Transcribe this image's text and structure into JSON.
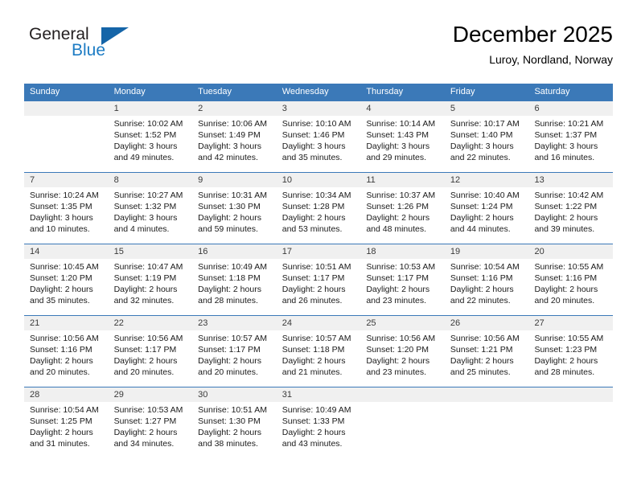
{
  "brand": {
    "word_one": "General",
    "word_two": "Blue",
    "accent_dark": "#1565a8",
    "accent_light": "#1d7cc4"
  },
  "header": {
    "title": "December 2025",
    "subtitle": "Luroy, Nordland, Norway"
  },
  "calendar": {
    "header_color": "#3b79b8",
    "daynum_band_color": "#f0f0f0",
    "weekdays": [
      "Sunday",
      "Monday",
      "Tuesday",
      "Wednesday",
      "Thursday",
      "Friday",
      "Saturday"
    ],
    "weeks": [
      {
        "days": [
          {
            "num": "",
            "sunrise": "",
            "sunset": "",
            "daylight_a": "",
            "daylight_b": ""
          },
          {
            "num": "1",
            "sunrise": "Sunrise: 10:02 AM",
            "sunset": "Sunset: 1:52 PM",
            "daylight_a": "Daylight: 3 hours",
            "daylight_b": "and 49 minutes."
          },
          {
            "num": "2",
            "sunrise": "Sunrise: 10:06 AM",
            "sunset": "Sunset: 1:49 PM",
            "daylight_a": "Daylight: 3 hours",
            "daylight_b": "and 42 minutes."
          },
          {
            "num": "3",
            "sunrise": "Sunrise: 10:10 AM",
            "sunset": "Sunset: 1:46 PM",
            "daylight_a": "Daylight: 3 hours",
            "daylight_b": "and 35 minutes."
          },
          {
            "num": "4",
            "sunrise": "Sunrise: 10:14 AM",
            "sunset": "Sunset: 1:43 PM",
            "daylight_a": "Daylight: 3 hours",
            "daylight_b": "and 29 minutes."
          },
          {
            "num": "5",
            "sunrise": "Sunrise: 10:17 AM",
            "sunset": "Sunset: 1:40 PM",
            "daylight_a": "Daylight: 3 hours",
            "daylight_b": "and 22 minutes."
          },
          {
            "num": "6",
            "sunrise": "Sunrise: 10:21 AM",
            "sunset": "Sunset: 1:37 PM",
            "daylight_a": "Daylight: 3 hours",
            "daylight_b": "and 16 minutes."
          }
        ]
      },
      {
        "days": [
          {
            "num": "7",
            "sunrise": "Sunrise: 10:24 AM",
            "sunset": "Sunset: 1:35 PM",
            "daylight_a": "Daylight: 3 hours",
            "daylight_b": "and 10 minutes."
          },
          {
            "num": "8",
            "sunrise": "Sunrise: 10:27 AM",
            "sunset": "Sunset: 1:32 PM",
            "daylight_a": "Daylight: 3 hours",
            "daylight_b": "and 4 minutes."
          },
          {
            "num": "9",
            "sunrise": "Sunrise: 10:31 AM",
            "sunset": "Sunset: 1:30 PM",
            "daylight_a": "Daylight: 2 hours",
            "daylight_b": "and 59 minutes."
          },
          {
            "num": "10",
            "sunrise": "Sunrise: 10:34 AM",
            "sunset": "Sunset: 1:28 PM",
            "daylight_a": "Daylight: 2 hours",
            "daylight_b": "and 53 minutes."
          },
          {
            "num": "11",
            "sunrise": "Sunrise: 10:37 AM",
            "sunset": "Sunset: 1:26 PM",
            "daylight_a": "Daylight: 2 hours",
            "daylight_b": "and 48 minutes."
          },
          {
            "num": "12",
            "sunrise": "Sunrise: 10:40 AM",
            "sunset": "Sunset: 1:24 PM",
            "daylight_a": "Daylight: 2 hours",
            "daylight_b": "and 44 minutes."
          },
          {
            "num": "13",
            "sunrise": "Sunrise: 10:42 AM",
            "sunset": "Sunset: 1:22 PM",
            "daylight_a": "Daylight: 2 hours",
            "daylight_b": "and 39 minutes."
          }
        ]
      },
      {
        "days": [
          {
            "num": "14",
            "sunrise": "Sunrise: 10:45 AM",
            "sunset": "Sunset: 1:20 PM",
            "daylight_a": "Daylight: 2 hours",
            "daylight_b": "and 35 minutes."
          },
          {
            "num": "15",
            "sunrise": "Sunrise: 10:47 AM",
            "sunset": "Sunset: 1:19 PM",
            "daylight_a": "Daylight: 2 hours",
            "daylight_b": "and 32 minutes."
          },
          {
            "num": "16",
            "sunrise": "Sunrise: 10:49 AM",
            "sunset": "Sunset: 1:18 PM",
            "daylight_a": "Daylight: 2 hours",
            "daylight_b": "and 28 minutes."
          },
          {
            "num": "17",
            "sunrise": "Sunrise: 10:51 AM",
            "sunset": "Sunset: 1:17 PM",
            "daylight_a": "Daylight: 2 hours",
            "daylight_b": "and 26 minutes."
          },
          {
            "num": "18",
            "sunrise": "Sunrise: 10:53 AM",
            "sunset": "Sunset: 1:17 PM",
            "daylight_a": "Daylight: 2 hours",
            "daylight_b": "and 23 minutes."
          },
          {
            "num": "19",
            "sunrise": "Sunrise: 10:54 AM",
            "sunset": "Sunset: 1:16 PM",
            "daylight_a": "Daylight: 2 hours",
            "daylight_b": "and 22 minutes."
          },
          {
            "num": "20",
            "sunrise": "Sunrise: 10:55 AM",
            "sunset": "Sunset: 1:16 PM",
            "daylight_a": "Daylight: 2 hours",
            "daylight_b": "and 20 minutes."
          }
        ]
      },
      {
        "days": [
          {
            "num": "21",
            "sunrise": "Sunrise: 10:56 AM",
            "sunset": "Sunset: 1:16 PM",
            "daylight_a": "Daylight: 2 hours",
            "daylight_b": "and 20 minutes."
          },
          {
            "num": "22",
            "sunrise": "Sunrise: 10:56 AM",
            "sunset": "Sunset: 1:17 PM",
            "daylight_a": "Daylight: 2 hours",
            "daylight_b": "and 20 minutes."
          },
          {
            "num": "23",
            "sunrise": "Sunrise: 10:57 AM",
            "sunset": "Sunset: 1:17 PM",
            "daylight_a": "Daylight: 2 hours",
            "daylight_b": "and 20 minutes."
          },
          {
            "num": "24",
            "sunrise": "Sunrise: 10:57 AM",
            "sunset": "Sunset: 1:18 PM",
            "daylight_a": "Daylight: 2 hours",
            "daylight_b": "and 21 minutes."
          },
          {
            "num": "25",
            "sunrise": "Sunrise: 10:56 AM",
            "sunset": "Sunset: 1:20 PM",
            "daylight_a": "Daylight: 2 hours",
            "daylight_b": "and 23 minutes."
          },
          {
            "num": "26",
            "sunrise": "Sunrise: 10:56 AM",
            "sunset": "Sunset: 1:21 PM",
            "daylight_a": "Daylight: 2 hours",
            "daylight_b": "and 25 minutes."
          },
          {
            "num": "27",
            "sunrise": "Sunrise: 10:55 AM",
            "sunset": "Sunset: 1:23 PM",
            "daylight_a": "Daylight: 2 hours",
            "daylight_b": "and 28 minutes."
          }
        ]
      },
      {
        "days": [
          {
            "num": "28",
            "sunrise": "Sunrise: 10:54 AM",
            "sunset": "Sunset: 1:25 PM",
            "daylight_a": "Daylight: 2 hours",
            "daylight_b": "and 31 minutes."
          },
          {
            "num": "29",
            "sunrise": "Sunrise: 10:53 AM",
            "sunset": "Sunset: 1:27 PM",
            "daylight_a": "Daylight: 2 hours",
            "daylight_b": "and 34 minutes."
          },
          {
            "num": "30",
            "sunrise": "Sunrise: 10:51 AM",
            "sunset": "Sunset: 1:30 PM",
            "daylight_a": "Daylight: 2 hours",
            "daylight_b": "and 38 minutes."
          },
          {
            "num": "31",
            "sunrise": "Sunrise: 10:49 AM",
            "sunset": "Sunset: 1:33 PM",
            "daylight_a": "Daylight: 2 hours",
            "daylight_b": "and 43 minutes."
          },
          {
            "num": "",
            "sunrise": "",
            "sunset": "",
            "daylight_a": "",
            "daylight_b": ""
          },
          {
            "num": "",
            "sunrise": "",
            "sunset": "",
            "daylight_a": "",
            "daylight_b": ""
          },
          {
            "num": "",
            "sunrise": "",
            "sunset": "",
            "daylight_a": "",
            "daylight_b": ""
          }
        ]
      }
    ]
  }
}
